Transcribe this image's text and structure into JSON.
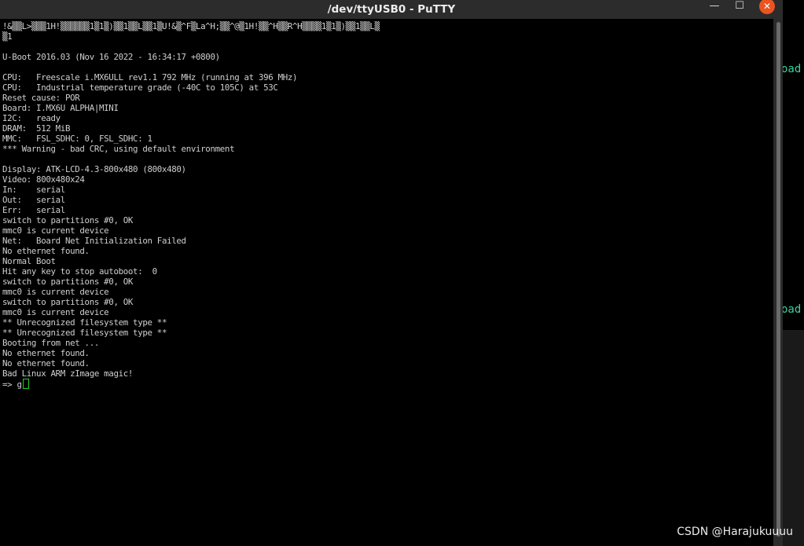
{
  "window": {
    "title": "/dev/ttyUSB0 - PuTTY",
    "minimize_label": "—",
    "maximize_label": "☐",
    "close_label": "✕"
  },
  "terminal": {
    "lines": [
      "!&▒▒L>▒▒▒1H!▒▒▒▒▒▒1▒1▒)▒▒1▒▒L▒▒1▒U!&▒^F▒La^H;▒▒^@▒1H!▒▒^H▒▒R^H▒▒▒▒1▒1▒)▒▒1▒▒L▒",
      "▒1",
      "",
      "U-Boot 2016.03 (Nov 16 2022 - 16:34:17 +0800)",
      "",
      "CPU:   Freescale i.MX6ULL rev1.1 792 MHz (running at 396 MHz)",
      "CPU:   Industrial temperature grade (-40C to 105C) at 53C",
      "Reset cause: POR",
      "Board: I.MX6U ALPHA|MINI",
      "I2C:   ready",
      "DRAM:  512 MiB",
      "MMC:   FSL_SDHC: 0, FSL_SDHC: 1",
      "*** Warning - bad CRC, using default environment",
      "",
      "Display: ATK-LCD-4.3-800x480 (800x480)",
      "Video: 800x480x24",
      "In:    serial",
      "Out:   serial",
      "Err:   serial",
      "switch to partitions #0, OK",
      "mmc0 is current device",
      "Net:   Board Net Initialization Failed",
      "No ethernet found.",
      "Normal Boot",
      "Hit any key to stop autoboot:  0",
      "switch to partitions #0, OK",
      "mmc0 is current device",
      "switch to partitions #0, OK",
      "mmc0 is current device",
      "** Unrecognized filesystem type **",
      "** Unrecognized filesystem type **",
      "Booting from net ...",
      "No ethernet found.",
      "No ethernet found.",
      "Bad Linux ARM zImage magic!"
    ],
    "prompt": "=> g"
  },
  "background": {
    "partial_text_1": "oad",
    "partial_text_2": "oad"
  },
  "watermark": "CSDN @Harajukuuuu",
  "colors": {
    "terminal_bg": "#000000",
    "terminal_fg": "#cfcfcf",
    "cursor": "#22d022",
    "close_button": "#e95420",
    "titlebar": "#2c2c2c"
  }
}
